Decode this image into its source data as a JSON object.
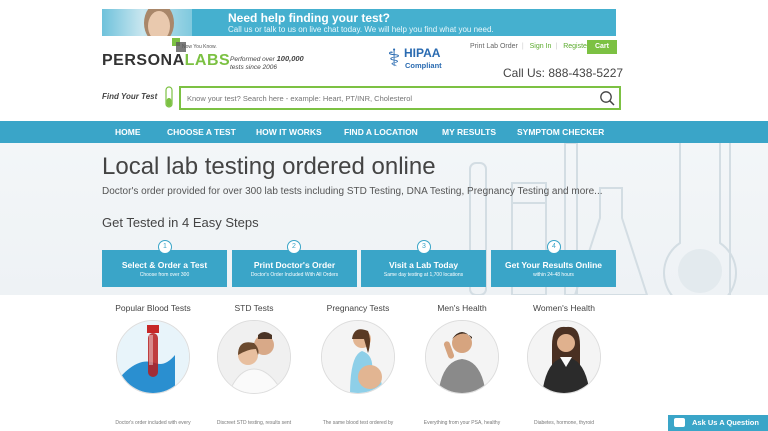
{
  "help_banner": {
    "title": "Need help finding your test?",
    "subtitle": "Call us or talk to us on live chat today. We will help you find what you need."
  },
  "logo": {
    "text_a": "PERSONA",
    "text_b": "LABS",
    "tagline": "Now You Know."
  },
  "performed": {
    "line1": "Performed over",
    "count": "100,000",
    "line2": "tests since 2006"
  },
  "hipaa": {
    "title": "HIPAA",
    "subtitle": "Compliant"
  },
  "util_links": {
    "print": "Print Lab Order",
    "signin": "Sign In",
    "register": "Register",
    "cart": "Cart"
  },
  "phone": "Call Us: 888-438-5227",
  "search": {
    "label": "Find Your Test",
    "placeholder": "Know your test? Search here - example: Heart, PT/INR, Cholesterol"
  },
  "nav": [
    "HOME",
    "CHOOSE A TEST",
    "HOW IT WORKS",
    "FIND A LOCATION",
    "MY RESULTS",
    "SYMPTOM CHECKER"
  ],
  "hero": {
    "title": "Local lab testing ordered online",
    "subtitle": "Doctor's order provided for over 300 lab tests including STD Testing, DNA Testing, Pregnancy Testing and more...",
    "steps_title": "Get Tested in 4 Easy Steps"
  },
  "steps": [
    {
      "num": "1",
      "title": "Select & Order a Test",
      "sub": "Choose from over 300"
    },
    {
      "num": "2",
      "title": "Print Doctor's Order",
      "sub": "Doctor's Order Included With All Orders"
    },
    {
      "num": "3",
      "title": "Visit a Lab Today",
      "sub": "Same day testing at 1,700 locations"
    },
    {
      "num": "4",
      "title": "Get Your Results Online",
      "sub": "within 24-48 hours"
    }
  ],
  "categories": [
    {
      "title": "Popular Blood Tests",
      "caption": "Doctor's order included with every"
    },
    {
      "title": "STD Tests",
      "caption": "Discreet STD testing, results sent"
    },
    {
      "title": "Pregnancy Tests",
      "caption": "The same blood test ordered by"
    },
    {
      "title": "Men's Health",
      "caption": "Everything from your PSA, healthy"
    },
    {
      "title": "Women's Health",
      "caption": "Diabetes, hormone, thyroid"
    }
  ],
  "ask_button": "Ask Us A Question",
  "colors": {
    "accent": "#3aa5c8",
    "brand_green": "#7cc143",
    "hipaa_blue": "#2a6bb1"
  }
}
